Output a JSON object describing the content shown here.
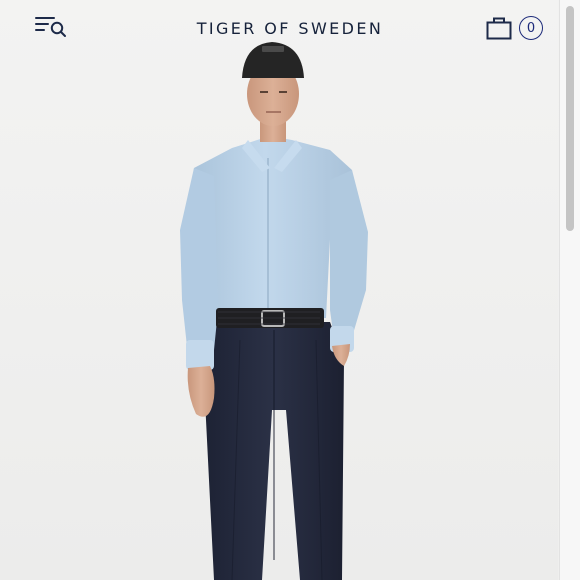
{
  "header": {
    "logo_text": "TIGER OF SWEDEN",
    "menu_search_icon": "menu-search-icon",
    "bag_icon": "shopping-bag-icon",
    "cart_count": "0"
  },
  "product": {
    "image_icon": "model-photo",
    "colors": {
      "background": "#f1f1f0",
      "cap": "#252525",
      "shirt": "#b9d2e8",
      "trousers": "#252a3d",
      "belt": "#1f1f22",
      "skin": "#d7a98e"
    }
  },
  "colors": {
    "brand_navy": "#16223b",
    "accent_blue": "#1c2a7a"
  }
}
